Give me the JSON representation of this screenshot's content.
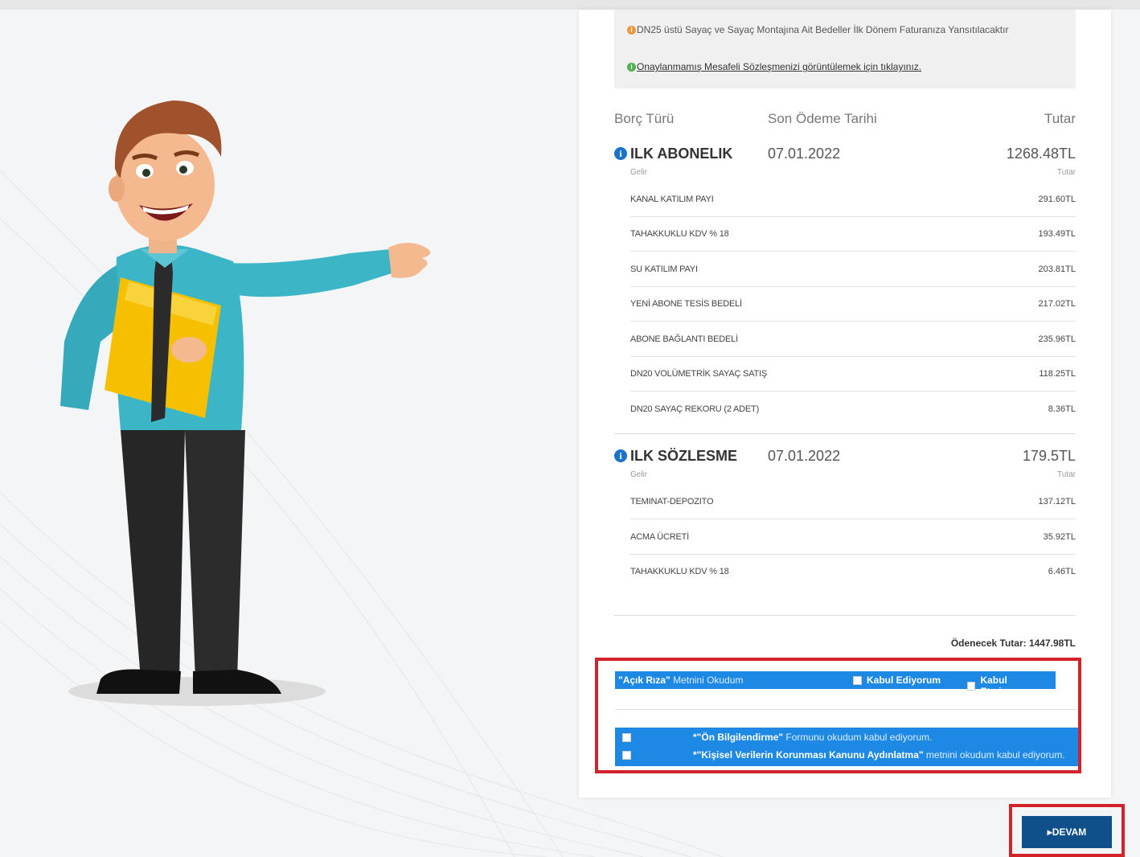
{
  "notice": {
    "line1": "DN25 üstü Sayaç ve Sayaç Montajına Ait Bedeller İlk Dönem Faturanıza Yansıtılacaktır",
    "line2_link": "Onaylanmamış Mesafeli Sözleşmenizi görüntülemek için tıklayınız."
  },
  "table": {
    "headers": {
      "col1": "Borç Türü",
      "col2": "Son Ödeme Tarihi",
      "col3": "Tutar"
    },
    "sub_left": "Gelir",
    "sub_right": "Tutar",
    "groups": [
      {
        "name": "ILK ABONELIK",
        "date": "07.01.2022",
        "amount": "1268.48TL",
        "items": [
          {
            "label": "KANAL KATILIM PAYI",
            "amount": "291.60TL"
          },
          {
            "label": "TAHAKKUKLU KDV % 18",
            "amount": "193.49TL"
          },
          {
            "label": "SU KATILIM PAYI",
            "amount": "203.81TL"
          },
          {
            "label": "YENİ ABONE TESİS BEDELİ",
            "amount": "217.02TL"
          },
          {
            "label": "ABONE BAĞLANTI BEDELİ",
            "amount": "235.96TL"
          },
          {
            "label": "DN20 VOLÜMETRİK SAYAÇ SATIŞ",
            "amount": "118.25TL"
          },
          {
            "label": "DN20 SAYAÇ REKORU (2 ADET)",
            "amount": "8.36TL"
          }
        ]
      },
      {
        "name": "ILK SÖZLESME",
        "date": "07.01.2022",
        "amount": "179.5TL",
        "items": [
          {
            "label": "TEMINAT-DEPOZITO",
            "amount": "137.12TL"
          },
          {
            "label": "ACMA ÜCRETİ",
            "amount": "35.92TL"
          },
          {
            "label": "TAHAKKUKLU KDV % 18",
            "amount": "6.46TL"
          }
        ]
      }
    ],
    "total_label": "Ödenecek Tutar: 1447.98TL"
  },
  "consent": {
    "acik_riza_bold": "\"Açık Rıza\"",
    "acik_riza_rest": " Metnini Okudum",
    "accept_label": "Kabul Ediyorum",
    "reject_label": "Kabul Etmiyorum",
    "on_bilgi_bold": "*\"Ön Bilgilendirme\"",
    "on_bilgi_rest": " Formunu okudum kabul ediyorum.",
    "kvkk_bold": "*\"Kişisel Verilerin Korunması Kanunu Aydınlatma\"",
    "kvkk_rest": " metnini okudum kabul ediyorum."
  },
  "devam_label": "▸DEVAM",
  "colors": {
    "primary_blue": "#1e88e5",
    "button_navy": "#0f4f8a",
    "highlight_red": "#d3222a",
    "info_blue": "#1a73c9",
    "orange_info": "#f0963c",
    "green_info": "#4caf50"
  }
}
